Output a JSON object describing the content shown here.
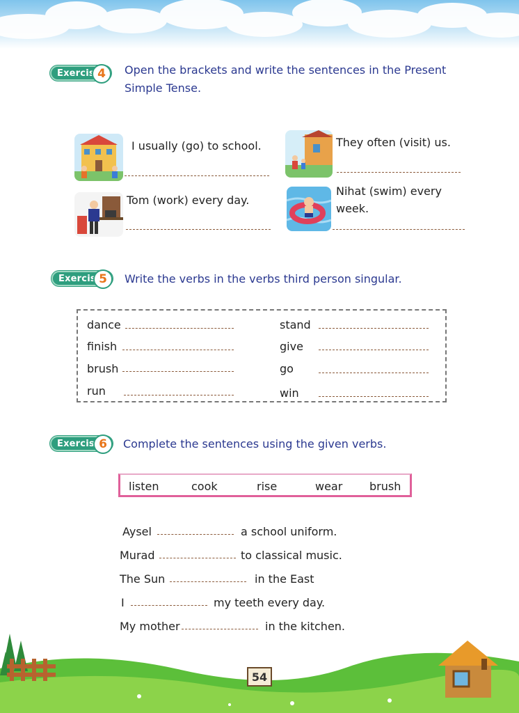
{
  "exercise4": {
    "badge_label": "Exercise",
    "badge_number": "4",
    "instruction": "Open the brackets and write the sentences in the Present Simple Tense.",
    "items": [
      {
        "sentence": "I usually (go) to school.",
        "icon": "school-picture"
      },
      {
        "sentence": "They often (visit) us.",
        "icon": "family-visit-picture"
      },
      {
        "sentence": "Tom (work) every day.",
        "icon": "office-worker-picture"
      },
      {
        "sentence": "Nihat (swim) every week.",
        "icon": "swimming-boy-picture"
      }
    ]
  },
  "exercise5": {
    "badge_label": "Exercise",
    "badge_number": "5",
    "instruction": "Write the verbs in the verbs third person singular.",
    "left_verbs": [
      "dance",
      "finish",
      "brush",
      "run"
    ],
    "right_verbs": [
      "stand",
      "give",
      "go",
      "win"
    ]
  },
  "exercise6": {
    "badge_label": "Exercise",
    "badge_number": "6",
    "instruction": "Complete the sentences using the given verbs.",
    "word_box": [
      "listen",
      "cook",
      "rise",
      "wear",
      "brush"
    ],
    "sentences": [
      {
        "before": "Aysel",
        "after": "a school uniform."
      },
      {
        "before": "Murad",
        "after": "to classical music."
      },
      {
        "before": "The Sun",
        "after": "in the East"
      },
      {
        "before": "I",
        "after": "my teeth every day."
      },
      {
        "before": "My mother",
        "after": "in the kitchen."
      }
    ]
  },
  "page_number": "54",
  "colors": {
    "instruction": "#2b3990",
    "badge": "#2e9e7e",
    "badge_number": "#e8751a",
    "word_box_border": "#e0609a",
    "dotted_line": "#8a5a3a"
  }
}
